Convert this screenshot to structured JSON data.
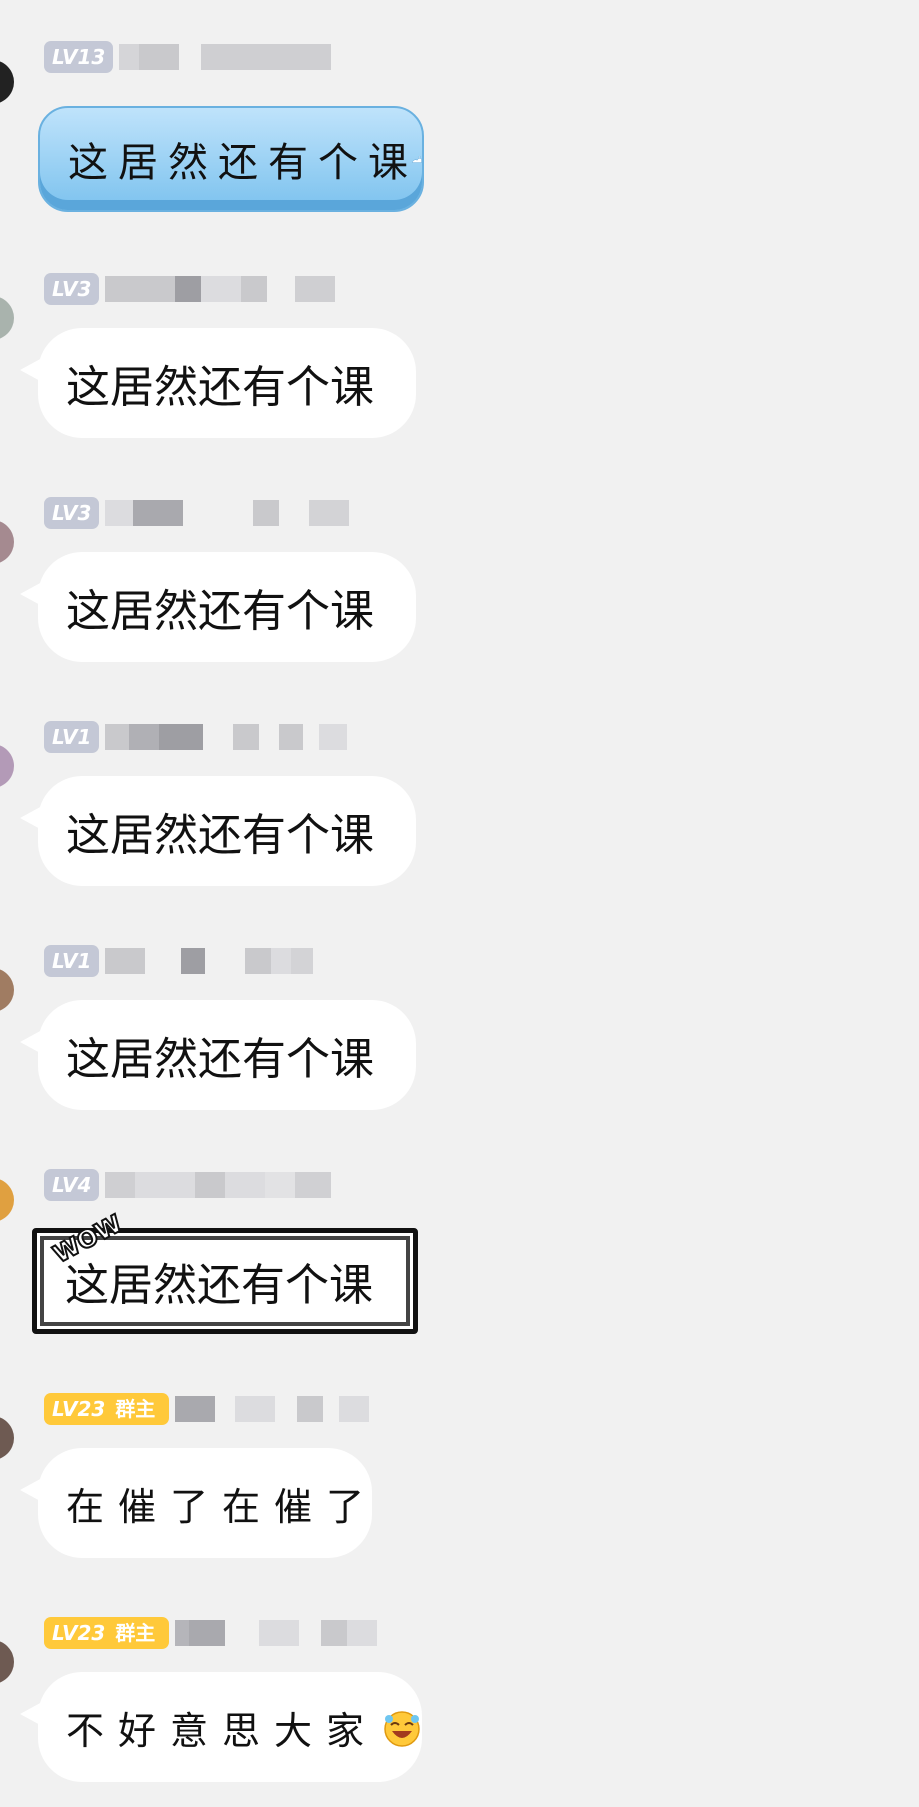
{
  "messages": [
    {
      "level": "LV13",
      "text": "这居然还有个课"
    },
    {
      "level": "LV3",
      "text": "这居然还有个课"
    },
    {
      "level": "LV3",
      "text": "这居然还有个课"
    },
    {
      "level": "LV1",
      "text": "这居然还有个课"
    },
    {
      "level": "LV1",
      "text": "这居然还有个课"
    },
    {
      "level": "LV4",
      "text": "这居然还有个课",
      "sticker": "WOW"
    },
    {
      "level": "LV23",
      "role": "群主",
      "text": "在催了在催了"
    },
    {
      "level": "LV23",
      "role": "群主",
      "text": "不好意思大家"
    }
  ],
  "icons": {
    "wave": "wave-icon",
    "laugh_emoji": "laughing-emoji-icon"
  },
  "colors": {
    "background": "#f1f1f1",
    "bubble": "#ffffff",
    "level_badge": "#c4c8d6",
    "owner_badge": "#ffc93a",
    "blue_bubble": "#8ecbf2"
  }
}
